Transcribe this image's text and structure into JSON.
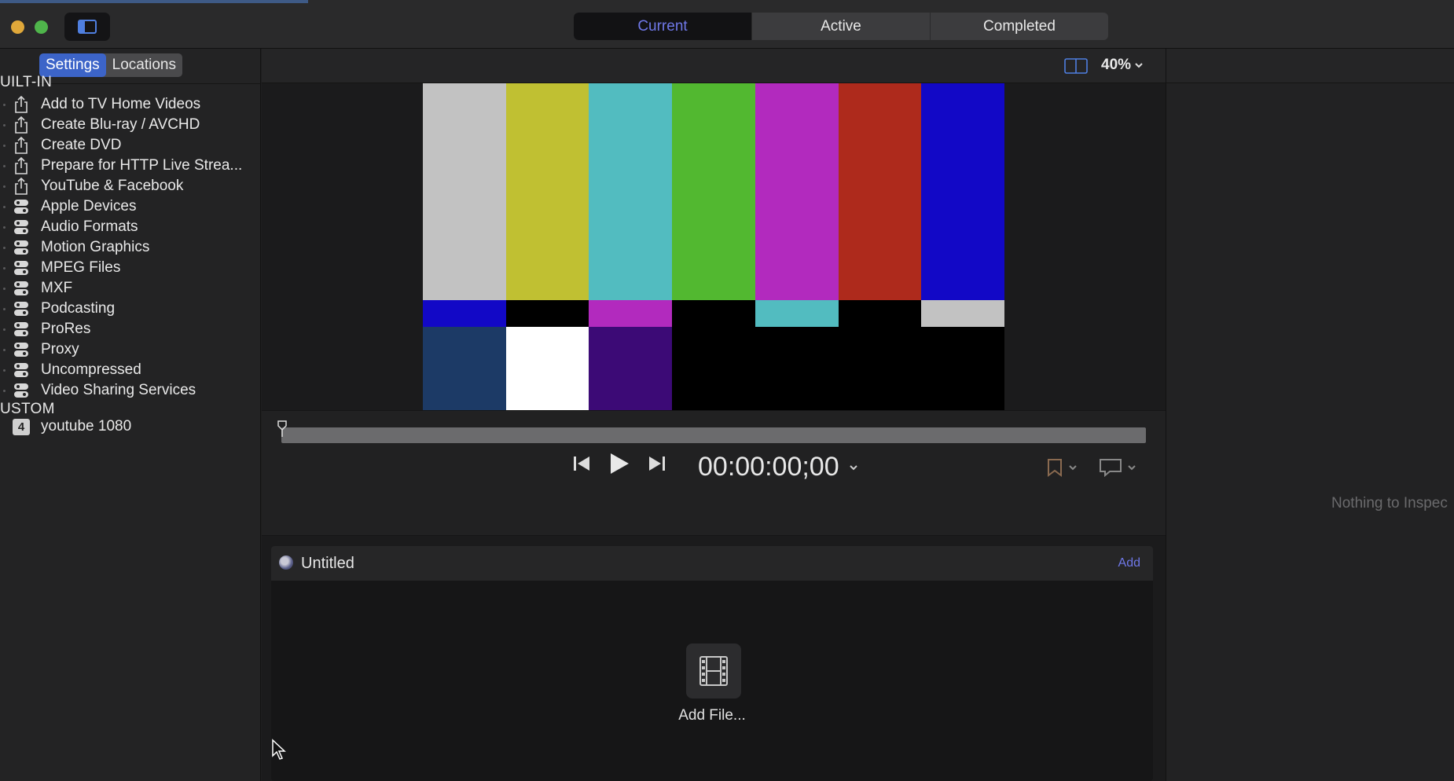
{
  "toolbar": {
    "tabs": [
      {
        "label": "Current",
        "active": true
      },
      {
        "label": "Active",
        "active": false
      },
      {
        "label": "Completed",
        "active": false
      }
    ]
  },
  "sidebar": {
    "tabs": [
      {
        "label": "Settings",
        "active": true
      },
      {
        "label": "Locations",
        "active": false
      }
    ],
    "builtin_header": "UILT-IN",
    "builtin_items": [
      {
        "label": "Add to TV Home Videos",
        "icon": "share-icon"
      },
      {
        "label": "Create Blu-ray / AVCHD",
        "icon": "share-icon"
      },
      {
        "label": "Create DVD",
        "icon": "share-icon"
      },
      {
        "label": "Prepare for HTTP Live Strea...",
        "icon": "share-icon"
      },
      {
        "label": "YouTube & Facebook",
        "icon": "share-icon"
      },
      {
        "label": "Apple Devices",
        "icon": "preset-group-icon"
      },
      {
        "label": "Audio Formats",
        "icon": "preset-group-icon"
      },
      {
        "label": "Motion Graphics",
        "icon": "preset-group-icon"
      },
      {
        "label": "MPEG Files",
        "icon": "preset-group-icon"
      },
      {
        "label": "MXF",
        "icon": "preset-group-icon"
      },
      {
        "label": "Podcasting",
        "icon": "preset-group-icon"
      },
      {
        "label": "ProRes",
        "icon": "preset-group-icon"
      },
      {
        "label": "Proxy",
        "icon": "preset-group-icon"
      },
      {
        "label": "Uncompressed",
        "icon": "preset-group-icon"
      },
      {
        "label": "Video Sharing Services",
        "icon": "preset-group-icon"
      }
    ],
    "custom_header": "USTOM",
    "custom_items": [
      {
        "label": "youtube 1080",
        "badge": "4"
      }
    ]
  },
  "viewer": {
    "zoom": "40%",
    "timecode": "00:00:00;00",
    "color_bars": {
      "top": [
        "#c2c2c2",
        "#c0c032",
        "#52bcc0",
        "#52b830",
        "#b22abe",
        "#ae2a1c",
        "#1208c6"
      ],
      "middle": [
        "#1208c6",
        "#000000",
        "#b22abe",
        "#000000",
        "#52bcc0",
        "#000000",
        "#c2c2c2"
      ],
      "bottom": [
        "#1c3a66",
        "#ffffff",
        "#3c0a76",
        "#000000",
        "#000000",
        "#000000",
        "#000000"
      ]
    }
  },
  "batch": {
    "title": "Untitled",
    "add_label": "Add",
    "drop_label": "Add File..."
  },
  "inspector": {
    "empty_text": "Nothing to Inspec"
  },
  "colors": {
    "accent": "#6f78e8",
    "selection": "#3c64c8"
  }
}
